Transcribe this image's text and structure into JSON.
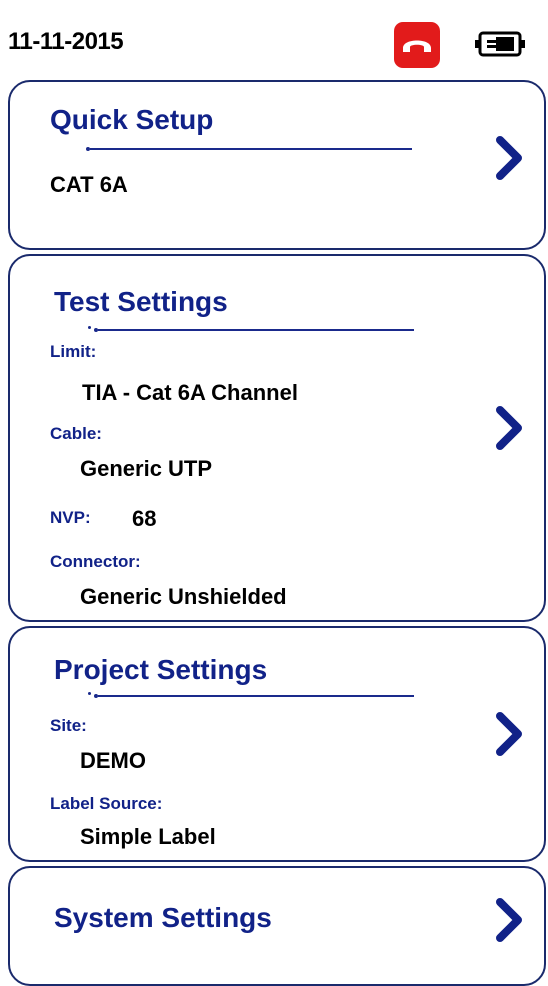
{
  "status_bar": {
    "date": "11-11-2015"
  },
  "colors": {
    "accent": "#112288",
    "border": "#1a2a6c",
    "call": "#e21b1b"
  },
  "icons": {
    "call": "call-end-icon",
    "battery": "battery-plug-icon",
    "chevron": "chevron-right-icon"
  },
  "quick_setup": {
    "title": "Quick Setup",
    "value": "CAT 6A"
  },
  "test_settings": {
    "title": "Test Settings",
    "limit_label": "Limit:",
    "limit_value": "TIA - Cat 6A Channel",
    "cable_label": "Cable:",
    "cable_value": "Generic UTP",
    "nvp_label": "NVP:",
    "nvp_value": "68",
    "connector_label": "Connector:",
    "connector_value": "Generic Unshielded"
  },
  "project_settings": {
    "title": "Project Settings",
    "site_label": "Site:",
    "site_value": "DEMO",
    "label_source_label": "Label Source:",
    "label_source_value": "Simple Label"
  },
  "system_settings": {
    "title": "System Settings"
  }
}
